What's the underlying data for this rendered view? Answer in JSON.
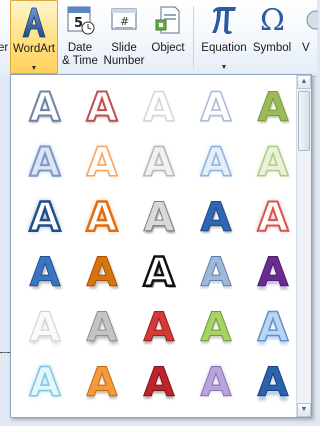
{
  "ribbon": {
    "partial_left_label": "er",
    "wordart": {
      "label": "WordArt",
      "has_dropdown": true,
      "state": "active"
    },
    "datetime": {
      "label": "Date\n& Time"
    },
    "slide_number": {
      "label": "Slide\nNumber"
    },
    "object": {
      "label": "Object"
    },
    "equation": {
      "label": "Equation",
      "has_dropdown": true
    },
    "symbol": {
      "label": "Symbol"
    },
    "partial_right_label": "V"
  },
  "gallery": {
    "glyph": "A",
    "styles": [
      "s1",
      "s2",
      "s3",
      "s4",
      "s5",
      "s6",
      "s7",
      "s8",
      "s9",
      "s10",
      "s11",
      "s12",
      "s13",
      "s14",
      "s15",
      "s16",
      "s17",
      "s18",
      "s19",
      "s20",
      "s21",
      "s22",
      "s23",
      "s24",
      "s25",
      "s26",
      "s27",
      "s28",
      "s29",
      "s30"
    ]
  },
  "colors": {
    "active_button": "#ffe38c",
    "gallery_border": "#8fa3bb",
    "ribbon_bg": "#f3f7fc"
  }
}
